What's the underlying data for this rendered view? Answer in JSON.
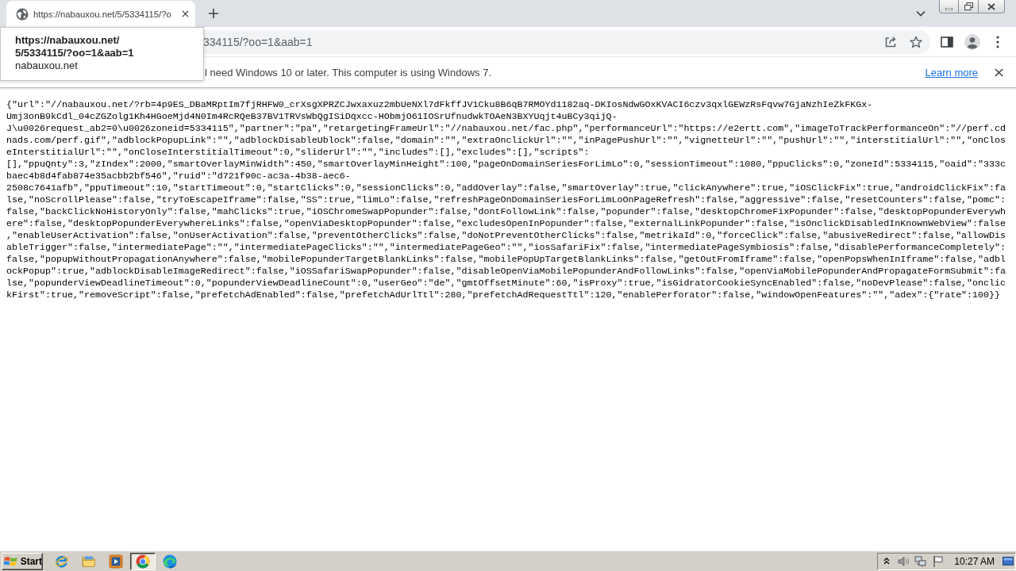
{
  "browser": {
    "tabs": [
      {
        "title": "https://nabauxou.net/5/5334115/?o",
        "selected": true
      }
    ],
    "tooltip": {
      "title_lines": [
        "https://nabauxou.net/",
        "5/5334115/?oo=1&aab=1"
      ],
      "domain": "nabauxou.net"
    },
    "address_bar": {
      "value": "334115/?oo=1&aab=1"
    }
  },
  "info_bar": {
    "message": "l need Windows 10 or later. This computer is using Windows 7.",
    "link": "Learn more"
  },
  "page": {
    "lines": [
      "{\"url\":\"//nabauxou.net/?rb=4p9ES_DBaMRptIm7fjRHFW0_crXsgXPRZCJwxaxuz2mbUeNXl7dFkffJV1Cku8B6qB7RMOYd1182aq-DKIosNdwGOxKVACI6czv3qxlGEWzRsFqvw7GjaNzhIeZkFKGx-",
      "Umj3onB9kCdl_04cZGZolg1Kh4HGoeMjd4N0Im4RcRQeB37BV1TRVsWbQgISiDqxcc-HObmjO61IOSrUfnudwkTOAeN3BXYUqjt4uBCy3qijQ-",
      "J\\u0026request_ab2=0\\u0026zoneid=5334115\",\"partner\":\"pa\",\"retargetingFrameUrl\":\"//nabauxou.net/fac.php\",\"performanceUrl\":\"https://e2ertt.com\",\"imageToTrackPerformanceOn\":\"//perf.cd",
      "nads.com/perf.gif\",\"adblockPopupLink\":\"\",\"adblockDisableUblock\":false,\"domain\":\"\",\"extraOnclickUrl\":\"\",\"inPagePushUrl\":\"\",\"vignetteUrl\":\"\",\"pushUrl\":\"\",\"interstitialUrl\":\"\",\"onClos",
      "eInterstitialUrl\":\"\",\"onCloseInterstitialTimeout\":0,\"sliderUrl\":\"\",\"includes\":[],\"excludes\":[],\"scripts\":",
      "[],\"ppuQnty\":3,\"zIndex\":2000,\"smartOverlayMinWidth\":450,\"smartOverlayMinHeight\":100,\"pageOnDomainSeriesForLimLo\":0,\"sessionTimeout\":1080,\"ppuClicks\":0,\"zoneId\":5334115,\"oaid\":\"333c",
      "baec4b8d4fab874e35acbb2bf546\",\"ruid\":\"d721f90c-ac3a-4b38-aec6-",
      "2508c7641afb\",\"ppuTimeout\":10,\"startTimeout\":0,\"startClicks\":0,\"sessionClicks\":0,\"addOverlay\":false,\"smartOverlay\":true,\"clickAnywhere\":true,\"iOSClickFix\":true,\"androidClickFix\":fa",
      "lse,\"noScrollPlease\":false,\"tryToEscapeIframe\":false,\"SS\":true,\"limLo\":false,\"refreshPageOnDomainSeriesForLimLoOnPageRefresh\":false,\"aggressive\":false,\"resetCounters\":false,\"pomc\":",
      "false,\"backClickNoHistoryOnly\":false,\"mahClicks\":true,\"iOSChromeSwapPopunder\":false,\"dontFollowLink\":false,\"popunder\":false,\"desktopChromeFixPopunder\":false,\"desktopPopunderEverywh",
      "ere\":false,\"desktopPopunderEverywhereLinks\":false,\"openViaDesktopPopunder\":false,\"excludesOpenInPopunder\":false,\"externalLinkPopunder\":false,\"isOnclickDisabledInKnownWebView\":false",
      ",\"enableUserActivation\":false,\"onUserActivation\":false,\"preventOtherClicks\":false,\"doNotPreventOtherClicks\":false,\"metrikaId\":0,\"forceClick\":false,\"abusiveRedirect\":false,\"allowDis",
      "ableTrigger\":false,\"intermediatePage\":\"\",\"intermediatePageClicks\":\"\",\"intermediatePageGeo\":\"\",\"iosSafariFix\":false,\"intermediatePageSymbiosis\":false,\"disablePerformanceCompletely\":",
      "false,\"popupWithoutPropagationAnywhere\":false,\"mobilePopunderTargetBlankLinks\":false,\"mobilePopUpTargetBlankLinks\":false,\"getOutFromIframe\":false,\"openPopsWhenInIframe\":false,\"adbl",
      "ockPopup\":true,\"adblockDisableImageRedirect\":false,\"iOSSafariSwapPopunder\":false,\"disableOpenViaMobilePopunderAndFollowLinks\":false,\"openViaMobilePopunderAndPropagateFormSubmit\":fa",
      "lse,\"popunderViewDeadlineTimeout\":0,\"popunderViewDeadlineCount\":0,\"userGeo\":\"de\",\"gmtOffsetMinute\":60,\"isProxy\":true,\"isGidratorCookieSyncEnabled\":false,\"noDevPlease\":false,\"onclic",
      "kFirst\":true,\"removeScript\":false,\"prefetchAdEnabled\":false,\"prefetchAdUrlTtl\":280,\"prefetchAdRequestTtl\":120,\"enablePerforator\":false,\"windowOpenFeatures\":\"\",\"adex\":{\"rate\":100}}"
    ]
  },
  "taskbar": {
    "start_label": "Start",
    "apps": [
      {
        "kind": "ie",
        "selected": false
      },
      {
        "kind": "folder",
        "selected": false
      },
      {
        "kind": "media",
        "selected": false
      },
      {
        "kind": "chrome",
        "selected": true
      },
      {
        "kind": "edge",
        "selected": false
      }
    ],
    "clock": "10:27 AM"
  }
}
